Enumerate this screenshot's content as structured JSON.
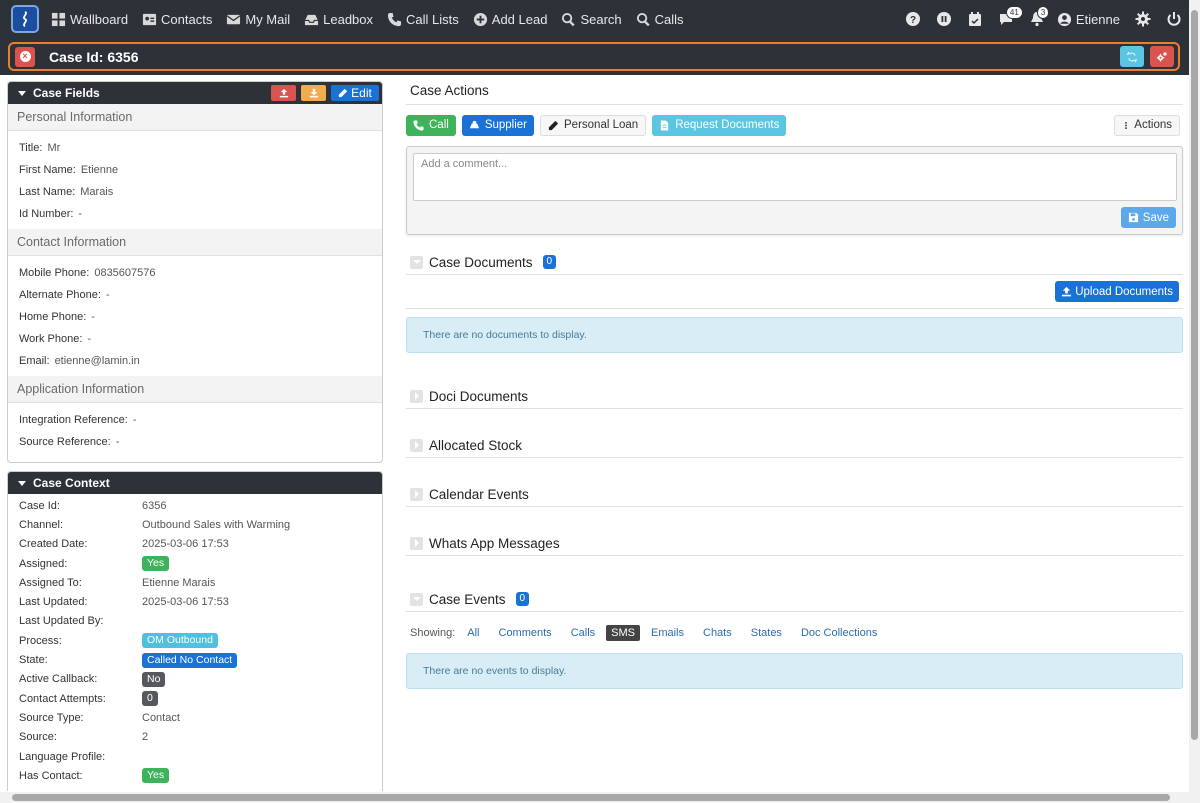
{
  "nav": {
    "items": [
      {
        "label": "Wallboard",
        "icon": "grid-icon"
      },
      {
        "label": "Contacts",
        "icon": "contact-card-icon"
      },
      {
        "label": "My Mail",
        "icon": "envelope-icon"
      },
      {
        "label": "Leadbox",
        "icon": "inbox-icon"
      },
      {
        "label": "Call Lists",
        "icon": "phone-list-icon"
      },
      {
        "label": "Add Lead",
        "icon": "plus-circle-icon"
      },
      {
        "label": "Search",
        "icon": "search-icon"
      },
      {
        "label": "Calls",
        "icon": "search-icon"
      }
    ],
    "messages_count": "41",
    "notifications_count": "3",
    "user": "Etienne"
  },
  "case": {
    "title": "Case Id: 6356"
  },
  "case_fields": {
    "title": "Case Fields",
    "edit_label": "Edit",
    "sections": [
      {
        "title": "Personal Information",
        "fields": [
          {
            "label": "Title:",
            "value": "Mr"
          },
          {
            "label": "First Name:",
            "value": "Etienne"
          },
          {
            "label": "Last Name:",
            "value": "Marais"
          },
          {
            "label": "Id Number:",
            "value": "-"
          }
        ]
      },
      {
        "title": "Contact Information",
        "fields": [
          {
            "label": "Mobile Phone:",
            "value": "0835607576"
          },
          {
            "label": "Alternate Phone:",
            "value": "-"
          },
          {
            "label": "Home Phone:",
            "value": "-"
          },
          {
            "label": "Work Phone:",
            "value": "-"
          },
          {
            "label": "Email:",
            "value": "etienne@lamin.in"
          }
        ]
      },
      {
        "title": "Application Information",
        "fields": [
          {
            "label": "Integration Reference:",
            "value": "-"
          },
          {
            "label": "Source Reference:",
            "value": "-"
          }
        ]
      }
    ]
  },
  "case_context": {
    "title": "Case Context",
    "rows": [
      {
        "label": "Case Id:",
        "value": "6356",
        "pill": ""
      },
      {
        "label": "Channel:",
        "value": "Outbound Sales with Warming",
        "pill": ""
      },
      {
        "label": "Created Date:",
        "value": "2025-03-06 17:53",
        "pill": ""
      },
      {
        "label": "Assigned:",
        "value": "Yes",
        "pill": "green"
      },
      {
        "label": "Assigned To:",
        "value": "Etienne Marais",
        "pill": ""
      },
      {
        "label": "Last Updated:",
        "value": "2025-03-06 17:53",
        "pill": ""
      },
      {
        "label": "Last Updated By:",
        "value": "",
        "pill": ""
      },
      {
        "label": "Process:",
        "value": "OM Outbound",
        "pill": "cyan"
      },
      {
        "label": "State:",
        "value": "Called No Contact",
        "pill": "blue"
      },
      {
        "label": "Active Callback:",
        "value": "No",
        "pill": "dark"
      },
      {
        "label": "Contact Attempts:",
        "value": "0",
        "pill": "dark"
      },
      {
        "label": "Source Type:",
        "value": "Contact",
        "pill": ""
      },
      {
        "label": "Source:",
        "value": "2",
        "pill": ""
      },
      {
        "label": "Language Profile:",
        "value": "",
        "pill": ""
      },
      {
        "label": "Has Contact:",
        "value": "Yes",
        "pill": "green"
      }
    ]
  },
  "case_actions": {
    "title": "Case Actions",
    "call_label": "Call",
    "supplier_label": "Supplier",
    "personal_loan_label": "Personal Loan",
    "request_documents_label": "Request Documents",
    "actions_label": "Actions",
    "comment_placeholder": "Add a comment...",
    "save_label": "Save"
  },
  "case_documents": {
    "title": "Case Documents",
    "count": "0",
    "upload_label": "Upload Documents",
    "empty_text": "There are no documents to display."
  },
  "collapsed_sections": [
    "Doci Documents",
    "Allocated Stock",
    "Calendar Events",
    "Whats App Messages"
  ],
  "case_events": {
    "title": "Case Events",
    "count": "0",
    "showing_label": "Showing:",
    "filters": [
      "All",
      "Comments",
      "Calls",
      "SMS",
      "Emails",
      "Chats",
      "States",
      "Doc Collections"
    ],
    "active_filter": "SMS",
    "empty_text": "There are no events to display."
  },
  "colors": {
    "nav_bg": "#2d3238",
    "case_border": "#f07c30",
    "primary": "#1a72d6",
    "success": "#3fb35c",
    "info": "#5bc6e2",
    "danger": "#d9534f",
    "warning": "#f0ad4e"
  }
}
